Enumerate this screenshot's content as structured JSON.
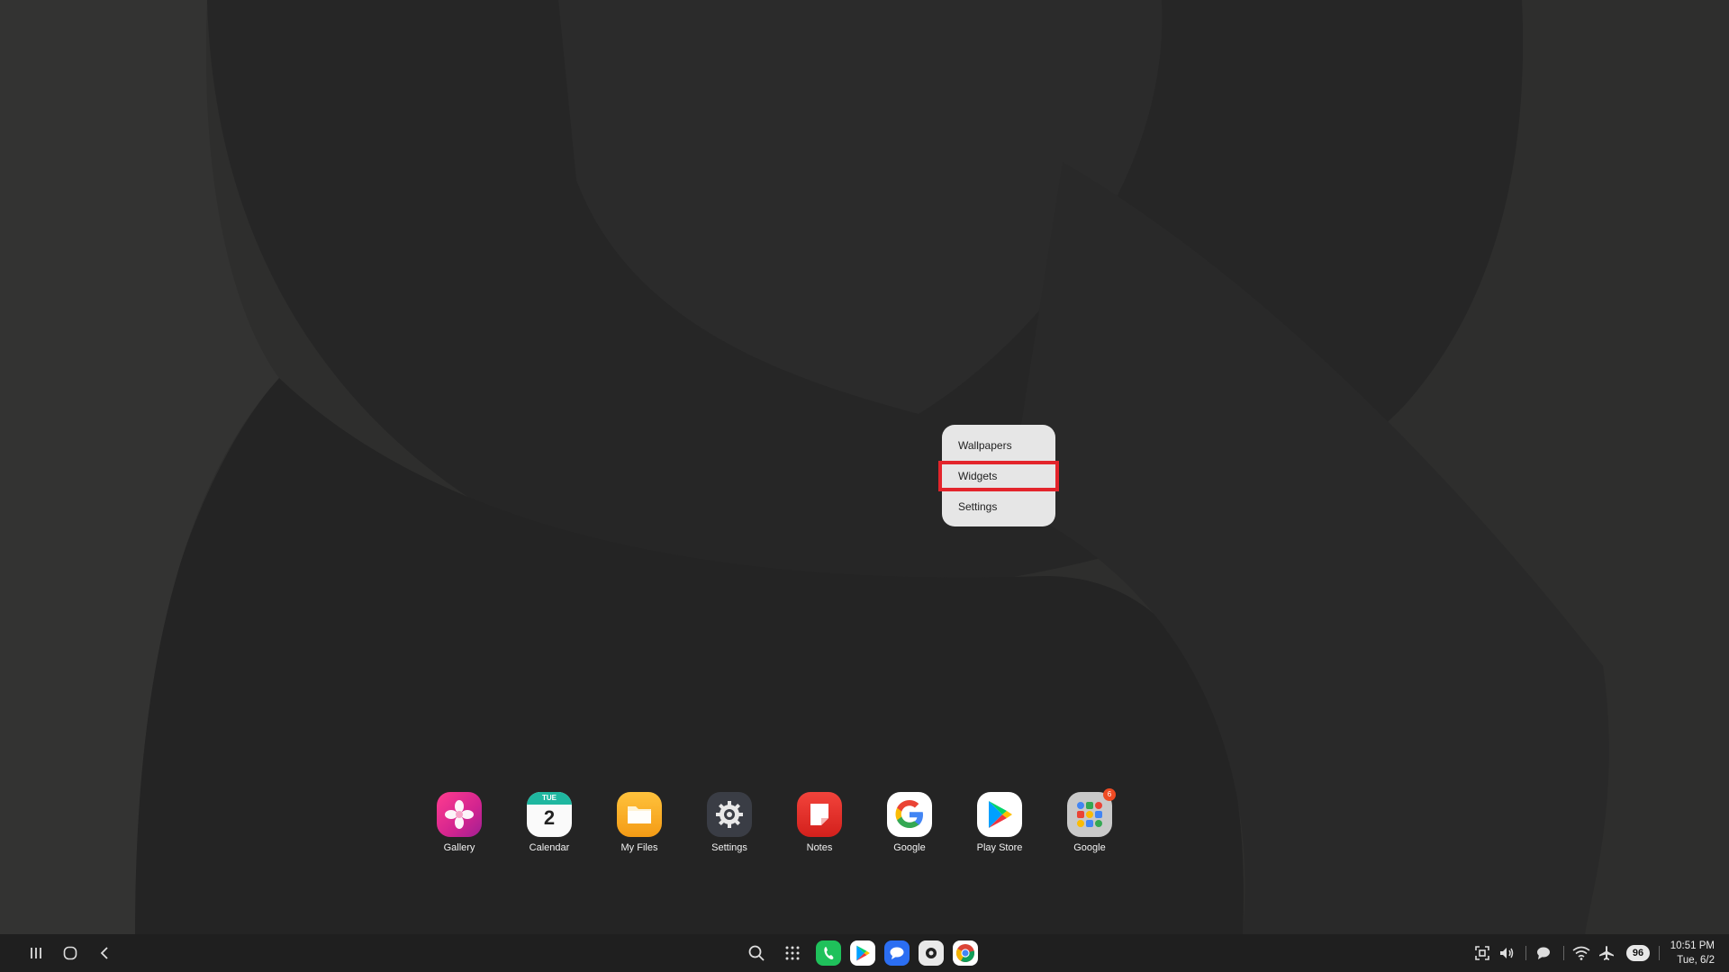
{
  "context_menu": {
    "items": [
      {
        "label": "Wallpapers"
      },
      {
        "label": "Widgets"
      },
      {
        "label": "Settings"
      }
    ]
  },
  "dock": {
    "apps": [
      {
        "label": "Gallery",
        "icon": "gallery-icon"
      },
      {
        "label": "Calendar",
        "icon": "calendar-icon",
        "weekday": "TUE",
        "day": "2"
      },
      {
        "label": "My Files",
        "icon": "folder-icon"
      },
      {
        "label": "Settings",
        "icon": "gear-icon"
      },
      {
        "label": "Notes",
        "icon": "notes-icon"
      },
      {
        "label": "Google",
        "icon": "google-g-icon"
      },
      {
        "label": "Play Store",
        "icon": "play-store-icon"
      },
      {
        "label": "Google",
        "icon": "app-folder-icon",
        "badge": "6"
      }
    ]
  },
  "taskbar": {
    "clock_time": "10:51 PM",
    "clock_date": "Tue, 6/2",
    "battery": "96"
  },
  "colors": {
    "highlight": "#e3242b",
    "taskbar": "#1f1f1f"
  }
}
